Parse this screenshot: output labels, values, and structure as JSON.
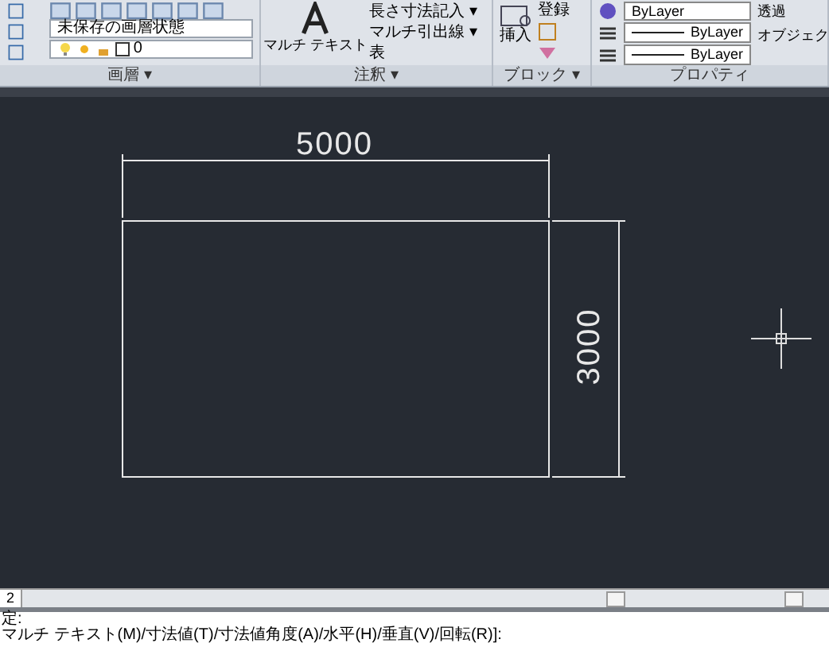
{
  "ribbon": {
    "panels": [
      {
        "kind": "layer",
        "title": "画層 ▾",
        "layer_state": "未保存の画層状態",
        "layer_name": "0"
      },
      {
        "kind": "annotation",
        "title": "注釈 ▾",
        "big_button": "マルチ テキスト",
        "items": [
          "長さ寸法記入 ▾",
          "マルチ引出線 ▾",
          "表"
        ]
      },
      {
        "kind": "block",
        "title": "ブロック ▾",
        "insert": "挿入",
        "items": [
          "登録"
        ]
      },
      {
        "kind": "properties",
        "title": "プロパティ",
        "color_setting": "ByLayer",
        "linetypes": [
          "ByLayer",
          "ByLayer"
        ],
        "extra": [
          "透過",
          "オブジェク"
        ]
      }
    ]
  },
  "drawing": {
    "width_dimension": "5000",
    "height_dimension": "3000"
  },
  "layout_tab": "2",
  "command_lines": [
    "定:",
    "マルチ テキスト(M)/寸法値(T)/寸法値角度(A)/水平(H)/垂直(V)/回転(R)]:"
  ]
}
